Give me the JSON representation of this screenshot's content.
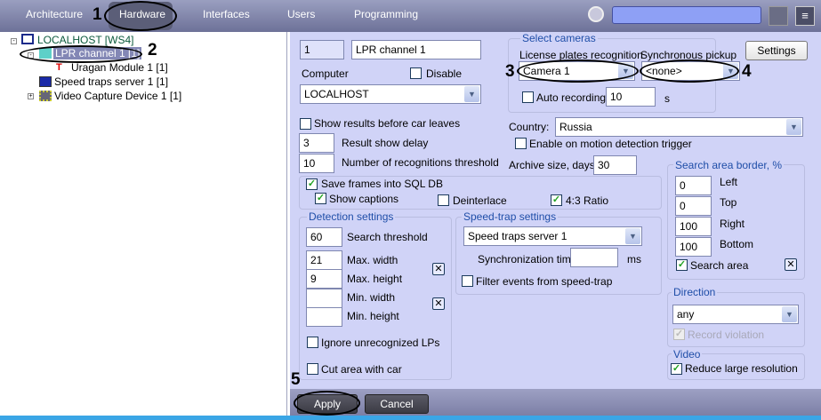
{
  "menu": {
    "tabs": [
      "Architecture",
      "Hardware",
      "Interfaces",
      "Users",
      "Programming"
    ],
    "active": "Hardware"
  },
  "annotations": [
    "1",
    "2",
    "3",
    "4",
    "5"
  ],
  "tree": {
    "root": "LOCALHOST [WS4]",
    "lpr": "LPR channel 1 [1]",
    "uragan": "Uragan Module 1 [1]",
    "speed": "Speed traps server 1 [1]",
    "video": "Video Capture Device 1 [1]"
  },
  "form": {
    "id": "1",
    "name": "LPR channel 1",
    "computer_label": "Computer",
    "disable_label": "Disable",
    "computer": "LOCALHOST",
    "select_cameras": "Select cameras",
    "lpr_label": "License plates recognition",
    "sync_label": "Synchronous pickup",
    "camera": "Camera 1",
    "sync": "<none>",
    "settings": "Settings",
    "auto_recording": "Auto recording",
    "auto_value": "10",
    "auto_unit": "s",
    "show_before_leaves": "Show results before car leaves",
    "result_delay": "3",
    "result_delay_label": "Result show delay",
    "recog_threshold": "10",
    "recog_threshold_label": "Number of recognitions threshold",
    "country_label": "Country:",
    "country": "Russia",
    "motion_trigger": "Enable on motion detection trigger",
    "archive_label": "Archive size, days:",
    "archive": "30",
    "save_frames": "Save frames into SQL DB",
    "show_captions": "Show captions",
    "deinterlace": "Deinterlace",
    "ratio": "4:3 Ratio",
    "detection": {
      "title": "Detection settings",
      "search_threshold": "60",
      "search_label": "Search threshold",
      "max_width": "21",
      "max_width_label": "Max. width",
      "max_height": "9",
      "max_height_label": "Max. height",
      "min_width": "",
      "min_width_label": "Min. width",
      "min_height": "",
      "min_height_label": "Min. height",
      "ignore": "Ignore unrecognized LPs",
      "cut": "Cut area with car"
    },
    "speedtrap": {
      "title": "Speed-trap settings",
      "server": "Speed traps server 1",
      "sync_time_label": "Synchronization time",
      "sync_time": "",
      "unit": "ms",
      "filter": "Filter events from speed-trap"
    },
    "search_area": {
      "title": "Search area border, %",
      "left": "0",
      "left_label": "Left",
      "top": "0",
      "top_label": "Top",
      "right": "100",
      "right_label": "Right",
      "bottom": "100",
      "bottom_label": "Bottom",
      "check": "Search area"
    },
    "direction": {
      "title": "Direction",
      "value": "any",
      "record": "Record violation"
    },
    "video": {
      "title": "Video",
      "reduce": "Reduce large resolution"
    }
  },
  "buttons": {
    "apply": "Apply",
    "cancel": "Cancel"
  }
}
